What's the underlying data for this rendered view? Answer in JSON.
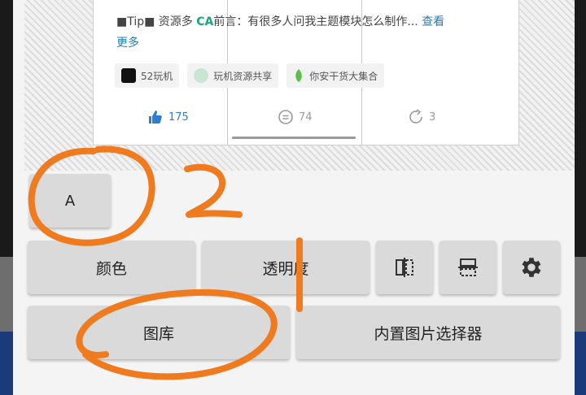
{
  "post": {
    "prefix": "■Tip■ 资源多",
    "logo_text": "CA",
    "body_text": "前言：有很多人问我主题模块怎么制作...",
    "more_link_1": "查看",
    "more_link_2": "更多",
    "tags": [
      {
        "label": "52玩机",
        "icon": "site-logo-icon"
      },
      {
        "label": "玩机资源共享",
        "icon": "community-icon"
      },
      {
        "label": "你安干货大集合",
        "icon": "leaf-icon"
      }
    ],
    "stats": {
      "likes": "175",
      "comments": "74",
      "shares": "3"
    }
  },
  "toolbar": {
    "text_style_label": "A",
    "color_label": "颜色",
    "opacity_label": "透明度",
    "gallery_label": "图库",
    "builtin_picker_label": "内置图片选择器"
  },
  "annotations": {
    "number_1": "1",
    "number_2": "2"
  },
  "colors": {
    "annotation": "#f07a1e",
    "link": "#1d7fb8",
    "like": "#2a7fd4"
  }
}
